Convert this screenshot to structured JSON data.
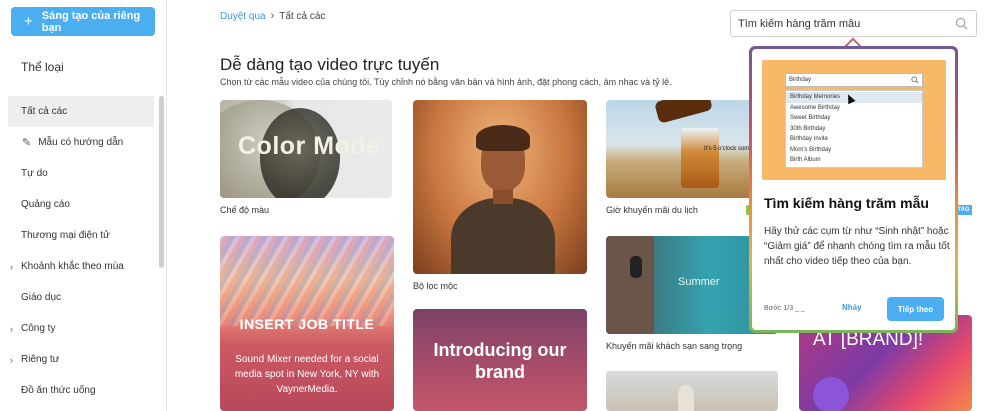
{
  "sidebar": {
    "create_label": "Sáng tạo của riêng bạn",
    "category_title": "Thể loại",
    "items": [
      {
        "label": "Tất cả các"
      },
      {
        "label": "Mẫu có hướng dẫn"
      },
      {
        "label": "Tự do"
      },
      {
        "label": "Quảng cáo"
      },
      {
        "label": "Thương mại điện tử"
      },
      {
        "label": "Khoảnh khắc theo mùa"
      },
      {
        "label": "Giáo dục"
      },
      {
        "label": "Công ty"
      },
      {
        "label": "Riêng tư"
      },
      {
        "label": "Đồ ăn thức uống"
      }
    ]
  },
  "breadcrumb": {
    "link": "Duyệt qua",
    "separator": "›",
    "current": "Tất cả các"
  },
  "search": {
    "value": "Tìm kiếm hàng trăm mẫu"
  },
  "main": {
    "heading": "Dễ dàng tạo video trực tuyến",
    "subheading": "Chọn từ các mẫu video của chúng tôi. Tùy chỉnh nó bằng văn bản và hình ảnh, đặt phong cách, âm nhạc và tỷ lệ."
  },
  "cards": {
    "color_mode": {
      "overlay": "Color Mode",
      "label": "Chế độ màu"
    },
    "filter": {
      "label": "Bộ lọc mộc"
    },
    "drink": {
      "overlay": "It's 5 o'clock som",
      "label": "Giờ khuyến mãi du lịch"
    },
    "job": {
      "title": "INSERT JOB TITLE",
      "desc": "Sound Mixer needed for a social media spot in New York, NY with VaynerMedia."
    },
    "brand": {
      "title": "Introducing our brand"
    },
    "hotel": {
      "overlay": "Summer",
      "label": "Khuyến mãi khách sạn sang trọng"
    },
    "brand2": {
      "title": "AT [BRAND]!"
    },
    "badge": "TAG"
  },
  "popover": {
    "preview_search": "Birthday",
    "preview_items": [
      "Birthday Memories",
      "Awesome Birthday",
      "Sweet Birthday",
      "30th Birthday",
      "Birthday Invite",
      "Mom's Birthday",
      "Birth Album"
    ],
    "title": "Tìm kiếm hàng trăm mẫu",
    "text": "Hãy thử các cụm từ như “Sinh nhật” hoặc “Giảm giá” để nhanh chóng tìm ra mẫu tốt nhất cho video tiếp theo của bạn.",
    "step": "Bước 1/3 _ _",
    "skip": "Nhảy",
    "next": "Tiếp theo"
  },
  "colors": {
    "accent": "#4aaef0",
    "link": "#3a9ae0"
  }
}
